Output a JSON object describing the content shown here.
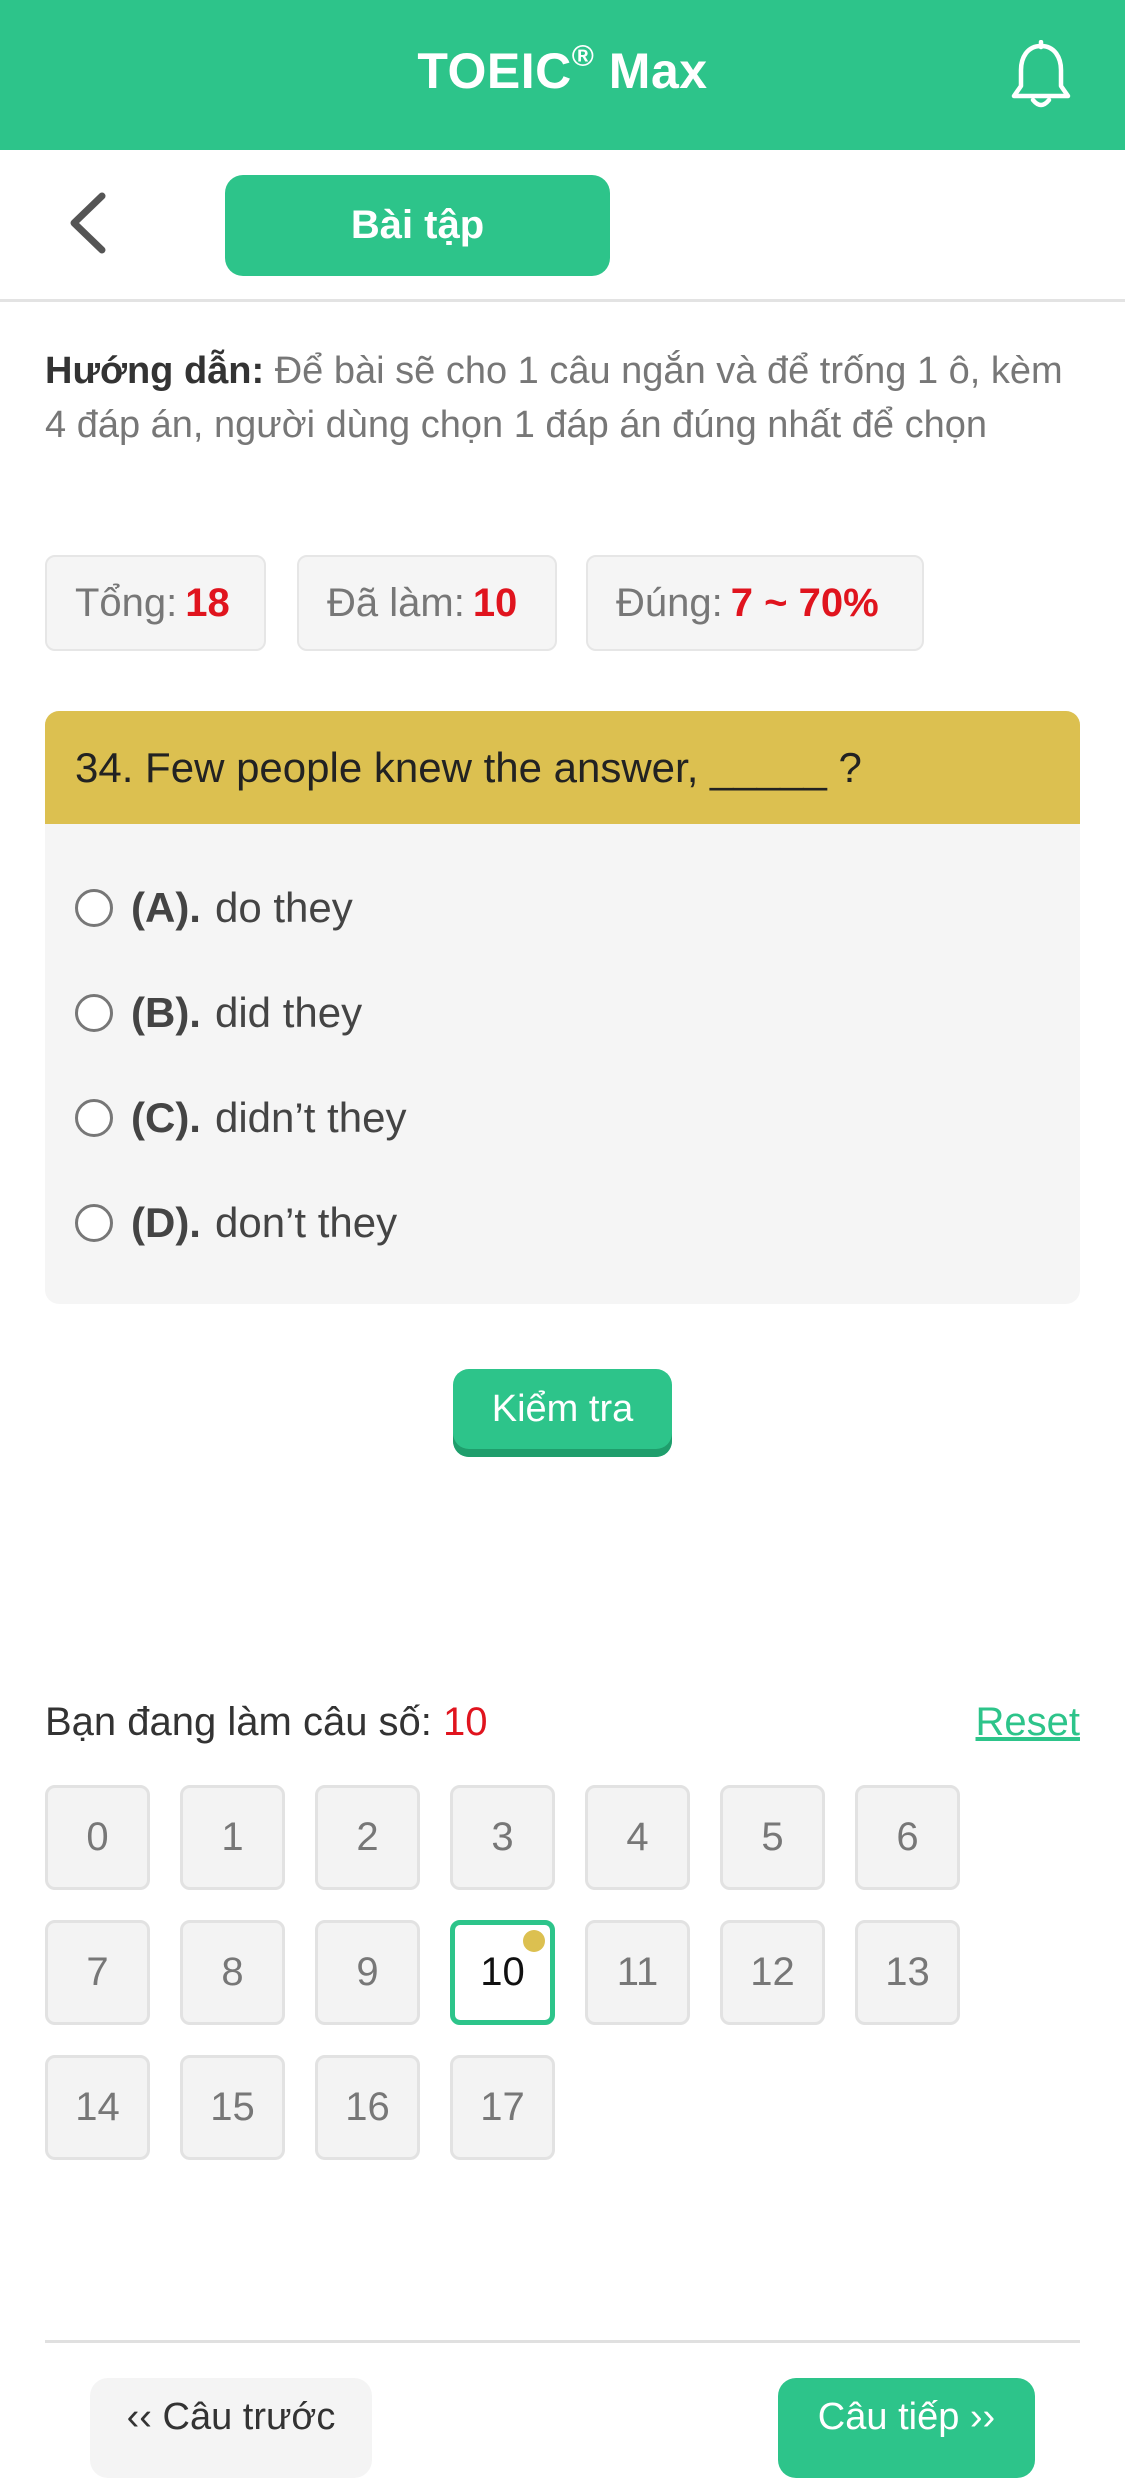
{
  "header": {
    "title": "TOEIC",
    "title_mark": "®",
    "title_suffix": " Max",
    "bell_icon": "bell-icon"
  },
  "subbar": {
    "back_icon": "chevron-left-icon",
    "tab_label": "Bài tập"
  },
  "instructions": {
    "label": "Hướng dẫn:",
    "text": " Để bài sẽ cho 1 câu ngắn và để trống 1 ô, kèm 4 đáp án, người dùng chọn 1 đáp án đúng nhất để chọn"
  },
  "stats": [
    {
      "label": "Tổng:",
      "value": "18"
    },
    {
      "label": "Đã làm:",
      "value": "10"
    },
    {
      "label": "Đúng:",
      "value": "7 ~ 70%"
    }
  ],
  "question": {
    "text": "34. Few people knew the answer, _____ ?",
    "options": [
      {
        "letter": "(A).",
        "text": "do they"
      },
      {
        "letter": "(B).",
        "text": "did they"
      },
      {
        "letter": "(C).",
        "text": "didn’t they"
      },
      {
        "letter": "(D).",
        "text": "don’t they"
      }
    ]
  },
  "check_button": "Kiểm tra",
  "progress": {
    "label": "Bạn đang làm câu số: ",
    "current": "10",
    "reset": "Reset"
  },
  "question_numbers": [
    "0",
    "1",
    "2",
    "3",
    "4",
    "5",
    "6",
    "7",
    "8",
    "9",
    "10",
    "11",
    "12",
    "13",
    "14",
    "15",
    "16",
    "17"
  ],
  "current_index": 10,
  "nav": {
    "prev": "‹‹ Câu trước",
    "next": "Câu tiếp ››"
  },
  "colors": {
    "brand_green": "#2dc48a",
    "question_header": "#dcc050",
    "accent_red": "#e0141e"
  }
}
